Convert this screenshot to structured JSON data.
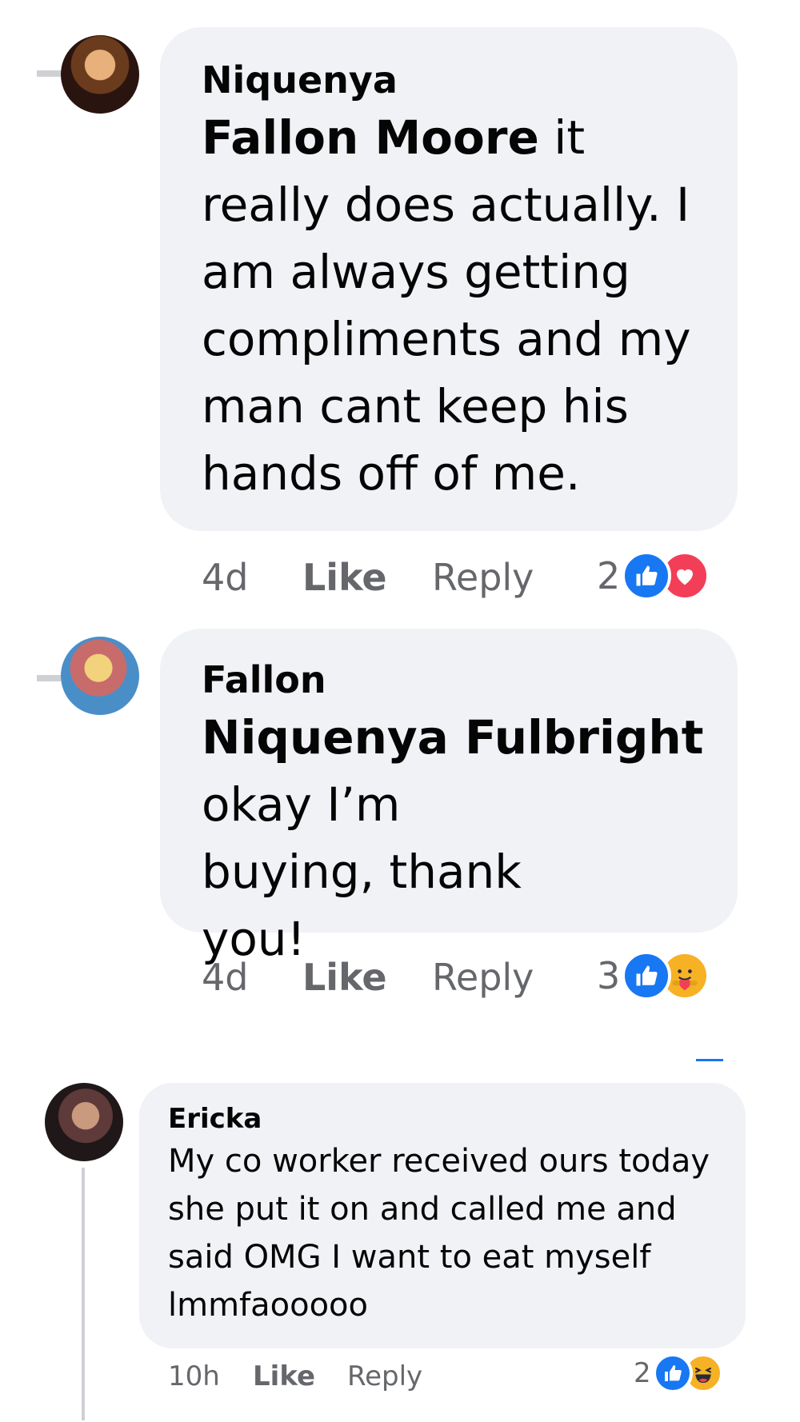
{
  "comments": [
    {
      "author": "Niquenya",
      "mention": "Fallon Moore",
      "text_rest": " it really does actually. I am always getting compliments and my man cant keep his hands off of me.",
      "time": "4d",
      "like_label": "Like",
      "reply_label": "Reply",
      "reaction_count": "2",
      "reactions": [
        "like-icon",
        "love-icon"
      ]
    },
    {
      "author": "Fallon",
      "mention": "Niquenya Fulbright",
      "text_rest": "okay I’m buying, thank you!",
      "time": "4d",
      "like_label": "Like",
      "reply_label": "Reply",
      "reaction_count": "3",
      "reactions": [
        "like-icon",
        "care-icon"
      ]
    },
    {
      "author": "Ericka",
      "text": "My co worker received ours today she put it on and called me and said OMG I want to eat myself lmmfaooooo",
      "time": "10h",
      "like_label": "Like",
      "reply_label": "Reply",
      "reaction_count": "2",
      "reactions": [
        "like-icon",
        "haha-icon"
      ]
    }
  ],
  "colors": {
    "bubble": "#f0f2f5",
    "like_blue": "#1877f2",
    "love_red": "#f33e58",
    "emoji_yellow": "#f7b125",
    "meta_gray": "#65676b"
  }
}
